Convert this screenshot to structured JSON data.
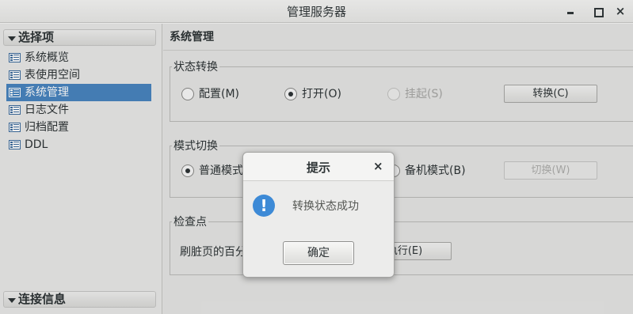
{
  "window": {
    "title": "管理服务器",
    "close_glyph": "×"
  },
  "sidebar": {
    "header": "选择项",
    "items": [
      {
        "label": "系统概览"
      },
      {
        "label": "表使用空间"
      },
      {
        "label": "系统管理",
        "selected": true
      },
      {
        "label": "日志文件"
      },
      {
        "label": "归档配置"
      },
      {
        "label": "DDL"
      }
    ],
    "footer": "连接信息"
  },
  "main": {
    "title": "系统管理",
    "state_group": {
      "legend": "状态转换",
      "options": [
        {
          "label": "配置(M)",
          "checked": false,
          "disabled": false
        },
        {
          "label": "打开(O)",
          "checked": true,
          "disabled": false
        },
        {
          "label": "挂起(S)",
          "checked": false,
          "disabled": true
        }
      ],
      "button": "转换(C)"
    },
    "mode_group": {
      "legend": "模式切换",
      "options": [
        {
          "label": "普通模式",
          "checked": true
        },
        {
          "label": "备机模式(B)",
          "checked": false
        }
      ],
      "button": "切换(W)"
    },
    "checkpoint_group": {
      "legend": "检查点",
      "label": "刷脏页的百分",
      "button": "执行(E)"
    }
  },
  "dialog": {
    "title": "提示",
    "close_glyph": "×",
    "icon_glyph": "!",
    "message": "转换状态成功",
    "ok_label": "确定"
  },
  "colors": {
    "selection": "#4a86c1",
    "info_icon": "#3d8ad6"
  }
}
